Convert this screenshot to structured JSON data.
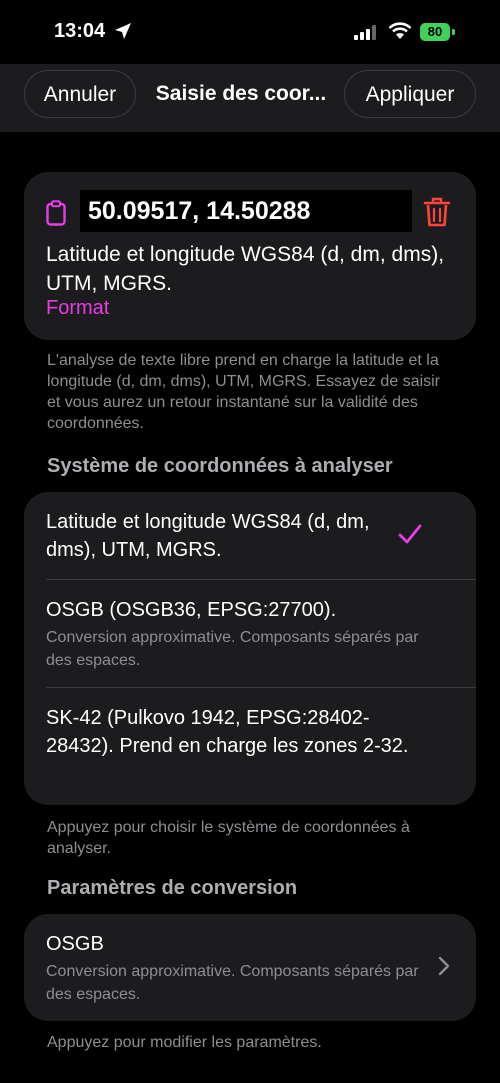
{
  "status": {
    "time": "13:04",
    "battery": "80"
  },
  "nav": {
    "cancel": "Annuler",
    "title": "Saisie des coor...",
    "apply": "Appliquer"
  },
  "input": {
    "value": "50.09517, 14.50288",
    "description": "Latitude et longitude WGS84 (d, dm, dms), UTM, MGRS.",
    "format_link": "Format"
  },
  "input_footer": "L'analyse de texte libre prend en charge la latitude et la longitude (d, dm, dms), UTM, MGRS. Essayez de saisir et vous aurez un retour instantané sur la validité des coordonnées.",
  "systems": {
    "header": "Système de coordonnées à analyser",
    "items": [
      {
        "title": "Latitude et longitude WGS84 (d, dm, dms), UTM, MGRS.",
        "subtitle": "",
        "selected": true
      },
      {
        "title": "OSGB (OSGB36, EPSG:27700).",
        "subtitle": "Conversion approximative. Composants séparés par des espaces.",
        "selected": false
      },
      {
        "title": "SK-42 (Pulkovo 1942, EPSG:28402-28432). Prend en charge les zones 2-32.",
        "subtitle": "",
        "selected": false
      }
    ],
    "footer": "Appuyez pour choisir le système de coordonnées à analyser."
  },
  "conversion": {
    "header": "Paramètres de conversion",
    "title": "OSGB",
    "subtitle": "Conversion approximative. Composants séparés par des espaces.",
    "footer": "Appuyez pour modifier les paramètres."
  },
  "colors": {
    "accent": "#e83ce6",
    "danger": "#ff453a",
    "battery": "#3fd158",
    "card": "#1c1c1e"
  },
  "icons": [
    "location-arrow-icon",
    "signal-icon",
    "wifi-icon",
    "clipboard-icon",
    "trash-icon",
    "checkmark-icon",
    "chevron-right-icon"
  ]
}
